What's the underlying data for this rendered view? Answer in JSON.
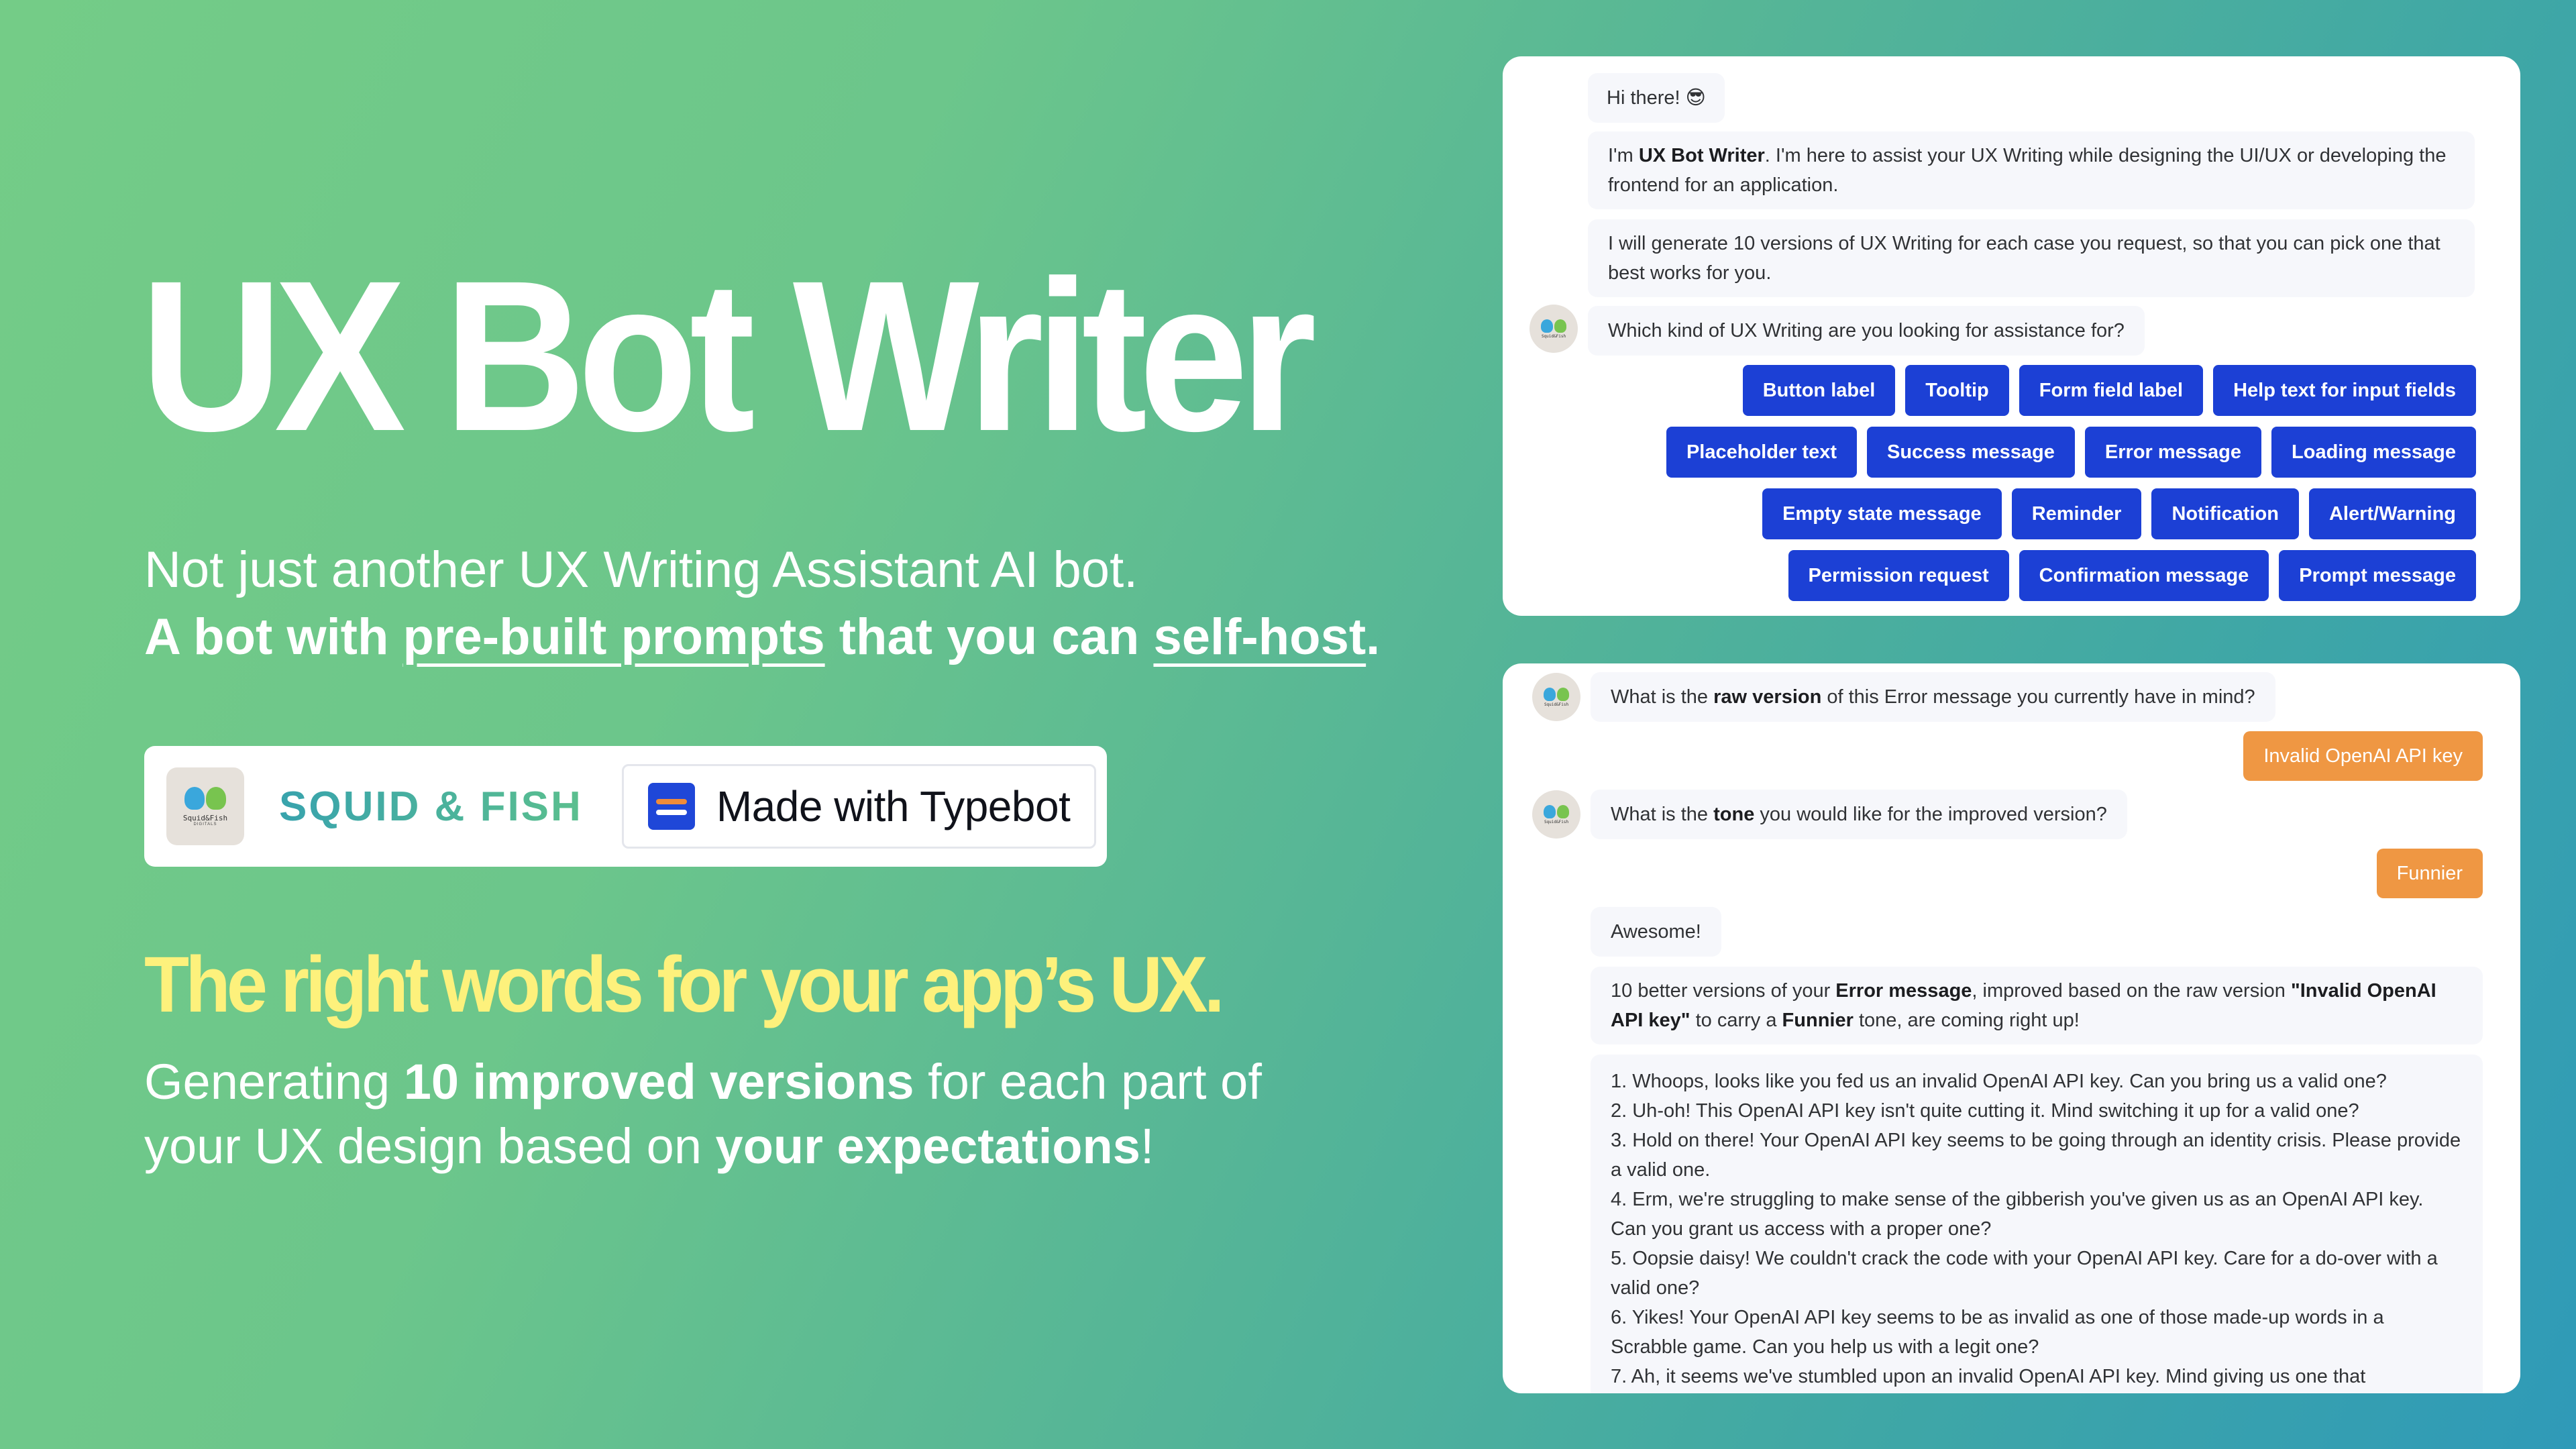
{
  "hero": {
    "title": "UX Bot Writer",
    "subtitle_line1": "Not just another UX Writing Assistant AI bot.",
    "subtitle_line2_parts": [
      "A bot with ",
      "pre-built prompts",
      " that you can ",
      "self-host",
      "."
    ],
    "brand": {
      "logo_name": "Squid&Fish",
      "logo_sub": "DIGITALS",
      "name": "SQUID & FISH",
      "badge_label": "Made with Typebot"
    },
    "tagline": "The right words for your app’s UX.",
    "desc_parts": [
      "Generating ",
      "10 improved versions",
      " for each part of your UX design based on ",
      "your expectations",
      "!"
    ]
  },
  "chat1": {
    "greeting": "Hi there! 😎",
    "intro_parts": [
      "I'm ",
      "UX Bot Writer",
      ". I'm here to assist your UX Writing while designing the UI/UX or developing the frontend for an application."
    ],
    "promise": "I will generate 10 versions of UX Writing for each case you request, so that you can pick one that best works for you.",
    "question": "Which kind of UX Writing are you looking for assistance for?",
    "choice_rows": [
      [
        "Button label",
        "Tooltip",
        "Form field label",
        "Help text for input fields"
      ],
      [
        "Placeholder text",
        "Success message",
        "Error message",
        "Loading message"
      ],
      [
        "Empty state message",
        "Reminder",
        "Notification",
        "Alert/Warning"
      ],
      [
        "Permission request",
        "Confirmation message",
        "Prompt message"
      ]
    ]
  },
  "chat2": {
    "q_raw_parts": [
      "What is the ",
      "raw version",
      " of this Error message you currently have in mind?"
    ],
    "answer_raw": "Invalid OpenAI API key",
    "q_tone_parts": [
      "What is the ",
      "tone",
      " you would like for the improved version?"
    ],
    "answer_tone": "Funnier",
    "awesome": "Awesome!",
    "summary_parts": [
      "10 better versions of your ",
      "Error message",
      ", improved based on the raw version ",
      "\"Invalid OpenAI API key\"",
      " to carry a ",
      "Funnier",
      " tone, are coming right up!"
    ],
    "results": [
      "1. Whoops, looks like you fed us an invalid OpenAI API key. Can you bring us a valid one?",
      "2. Uh-oh! This OpenAI API key isn't quite cutting it. Mind switching it up for a valid one?",
      "3. Hold on there! Your OpenAI API key seems to be going through an identity crisis. Please provide a valid one.",
      "4. Erm, we're struggling to make sense of the gibberish you've given us as an OpenAI API key. Can you grant us access with a proper one?",
      "5. Oopsie daisy! We couldn't crack the code with your OpenAI API key. Care for a do-over with a valid one?",
      "6. Yikes! Your OpenAI API key seems to be as invalid as one of those made-up words in a Scrabble game. Can you help us with a legit one?",
      "7. Ah, it seems we've stumbled upon an invalid OpenAI API key. Mind giving us one that"
    ]
  },
  "colors": {
    "choice_button": "#1c40d5",
    "user_bubble": "#ef9743",
    "bot_bubble": "#f6f7fb",
    "tagline": "#fdf17c"
  }
}
